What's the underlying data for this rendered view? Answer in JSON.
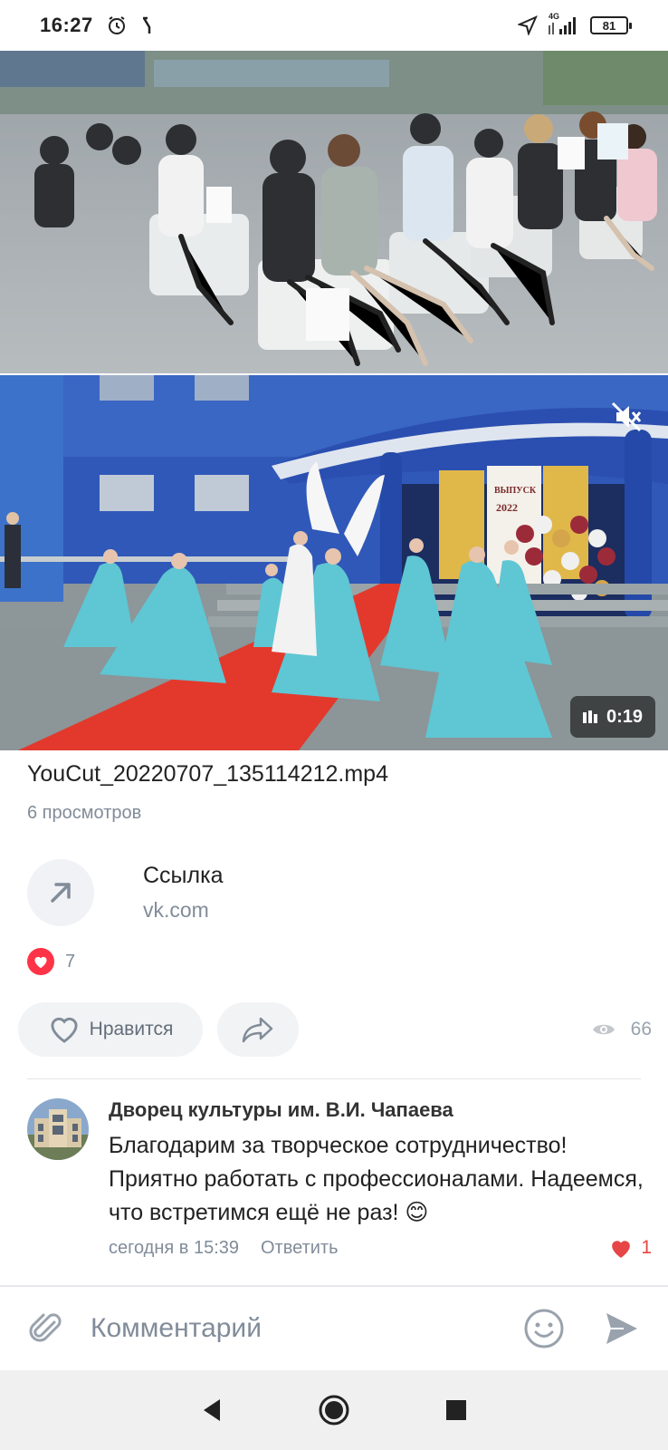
{
  "status_bar": {
    "time": "16:27",
    "network": "4G",
    "battery": "81"
  },
  "video": {
    "duration": "0:19",
    "file_name": "YouCut_20220707_135114212.mp4",
    "views": "6 просмотров"
  },
  "link": {
    "title": "Ссылка",
    "domain": "vk.com"
  },
  "likes": {
    "count": "7"
  },
  "actions": {
    "like_label": "Нравится",
    "views_total": "66"
  },
  "comment": {
    "author": "Дворец культуры им. В.И. Чапаева",
    "text": "Благодарим за творческое сотрудничество! Приятно работать с профессионалами. Надеемся, что встретимся ещё не раз! 😊",
    "time": "сегодня в 15:39",
    "reply_label": "Ответить",
    "like_count": "1"
  },
  "composer": {
    "placeholder": "Комментарий"
  },
  "colors": {
    "accent_red": "#ff3347",
    "link_blue": "#2a5885",
    "secondary_text": "#818c99"
  }
}
